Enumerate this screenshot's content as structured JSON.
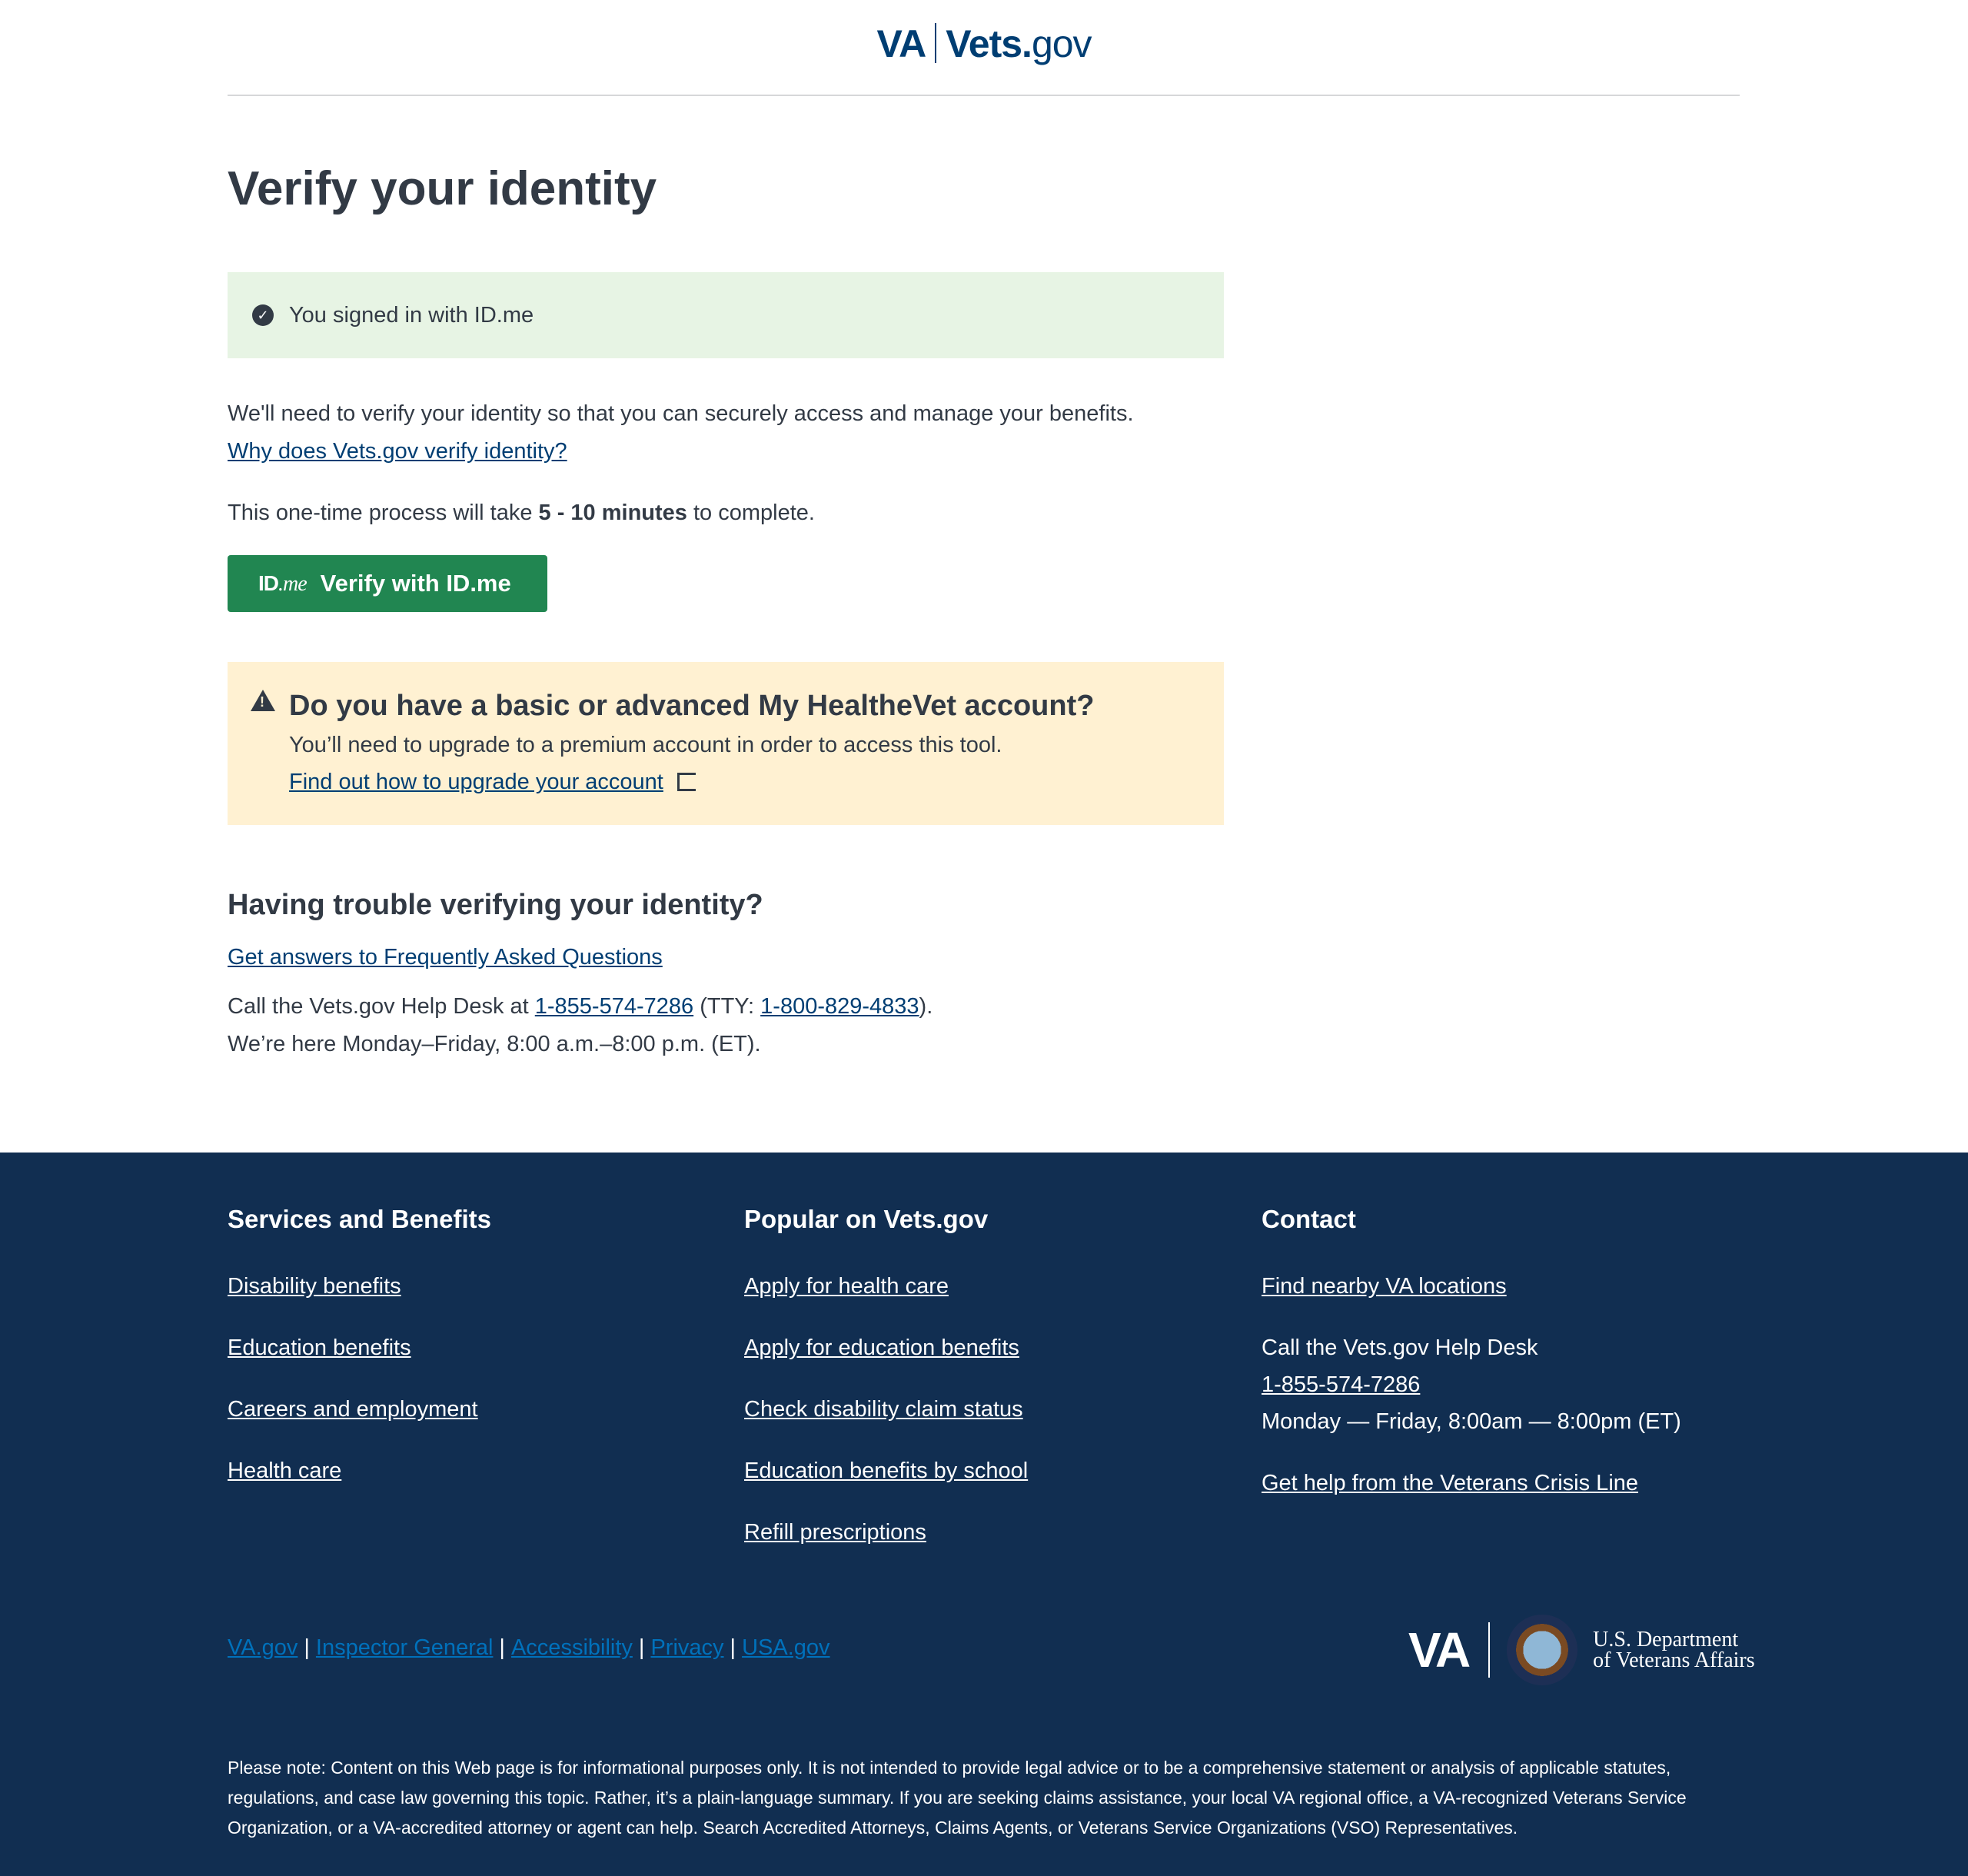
{
  "header": {
    "logo_va": "VA",
    "logo_vets": "Vets.",
    "logo_gov": "gov"
  },
  "main": {
    "title": "Verify your identity",
    "success_alert": "You signed in with ID.me",
    "intro": "We'll need to verify your identity so that you can securely access and manage your benefits.",
    "why_link": "Why does Vets.gov verify identity?",
    "process_pre": "This one-time process will take ",
    "process_bold": "5 - 10 minutes",
    "process_post": " to complete.",
    "verify_button": {
      "logo_id": "ID",
      "logo_me": ".me",
      "label": "Verify with ID.me",
      "color": "#218651"
    },
    "warning": {
      "title": "Do you have a basic or advanced My HealtheVet account?",
      "body": "You’ll need to upgrade to a premium account in order to access this tool.",
      "link": "Find out how to upgrade your account"
    },
    "trouble": {
      "title": "Having trouble verifying your identity?",
      "faq_link": "Get answers to Frequently Asked Questions",
      "call_pre": "Call the Vets.gov Help Desk at ",
      "phone": "1-855-574-7286",
      "tty_pre": " (TTY: ",
      "tty": "1-800-829-4833",
      "tty_post": ").",
      "hours": "We’re here Monday–Friday, 8:00 a.m.–8:00 p.m. (ET)."
    }
  },
  "footer": {
    "color": "#112e51",
    "services": {
      "title": "Services and Benefits",
      "links": [
        "Disability benefits",
        "Education benefits",
        "Careers and employment",
        "Health care"
      ]
    },
    "popular": {
      "title": "Popular on Vets.gov",
      "links": [
        "Apply for health care",
        "Apply for education benefits",
        "Check disability claim status",
        "Education benefits by school",
        "Refill prescriptions"
      ]
    },
    "contact": {
      "title": "Contact",
      "locations": "Find nearby VA locations",
      "helpdesk": "Call the Vets.gov Help Desk",
      "phone": "1-855-574-7286",
      "hours": "Monday — Friday, 8:00am — 8:00pm (ET)",
      "crisis": "Get help from the Veterans Crisis Line"
    },
    "bottom_links": [
      "VA.gov",
      "Inspector General",
      "Accessibility",
      "Privacy",
      "USA.gov"
    ],
    "logo": {
      "va": "VA",
      "dept1": "U.S. Department",
      "dept2": "of Veterans Affairs"
    },
    "disclaimer": "Please note: Content on this Web page is for informational purposes only. It is not intended to provide legal advice or to be a comprehensive statement or analysis of applicable statutes, regulations, and case law governing this topic. Rather, it’s a plain-language summary. If you are seeking claims assistance, your local VA regional office, a VA-recognized Veterans Service Organization, or a VA-accredited attorney or agent can help. Search Accredited Attorneys, Claims Agents, or Veterans Service Organizations (VSO) Representatives."
  }
}
